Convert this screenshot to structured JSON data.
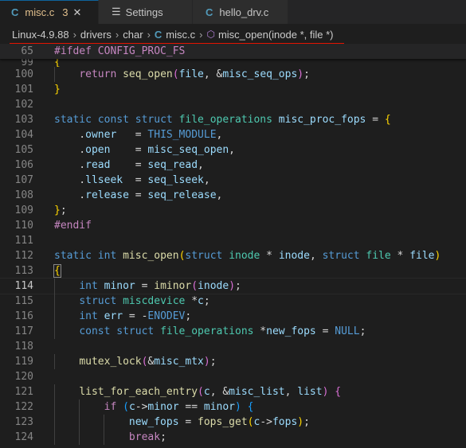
{
  "tabs": [
    {
      "icon": "C",
      "label": "misc.c",
      "badge": "3",
      "close": "✕",
      "active": true
    },
    {
      "icon": "☰",
      "label": "Settings",
      "active": false
    },
    {
      "icon": "C",
      "label": "hello_drv.c",
      "active": false
    }
  ],
  "breadcrumb": {
    "items": [
      "Linux-4.9.88",
      "drivers",
      "char",
      "misc.c",
      "misc_open(inode *, file *)"
    ],
    "file_icon": "C"
  },
  "sticky_line": {
    "num": "65",
    "text": "#ifdef CONFIG_PROC_FS"
  },
  "lines": [
    {
      "num": "99",
      "tokens": [
        {
          "c": "br1",
          "t": "{"
        }
      ]
    },
    {
      "num": "100",
      "tokens": [
        {
          "c": "pl",
          "t": "    "
        },
        {
          "c": "ctl",
          "t": "return"
        },
        {
          "c": "pl",
          "t": " "
        },
        {
          "c": "fn",
          "t": "seq_open"
        },
        {
          "c": "br2",
          "t": "("
        },
        {
          "c": "vr",
          "t": "file"
        },
        {
          "c": "pl",
          "t": ", &"
        },
        {
          "c": "vr",
          "t": "misc_seq_ops"
        },
        {
          "c": "br2",
          "t": ")"
        },
        {
          "c": "pl",
          "t": ";"
        }
      ]
    },
    {
      "num": "101",
      "tokens": [
        {
          "c": "br1",
          "t": "}"
        }
      ]
    },
    {
      "num": "102",
      "tokens": []
    },
    {
      "num": "103",
      "tokens": [
        {
          "c": "kw",
          "t": "static"
        },
        {
          "c": "pl",
          "t": " "
        },
        {
          "c": "kw",
          "t": "const"
        },
        {
          "c": "pl",
          "t": " "
        },
        {
          "c": "kw",
          "t": "struct"
        },
        {
          "c": "pl",
          "t": " "
        },
        {
          "c": "ty",
          "t": "file_operations"
        },
        {
          "c": "pl",
          "t": " "
        },
        {
          "c": "vr",
          "t": "misc_proc_fops"
        },
        {
          "c": "pl",
          "t": " = "
        },
        {
          "c": "br1",
          "t": "{"
        }
      ]
    },
    {
      "num": "104",
      "tokens": [
        {
          "c": "pl",
          "t": "    ."
        },
        {
          "c": "vr",
          "t": "owner"
        },
        {
          "c": "pl",
          "t": "   = "
        },
        {
          "c": "mac",
          "t": "THIS_MODULE"
        },
        {
          "c": "pl",
          "t": ","
        }
      ]
    },
    {
      "num": "105",
      "tokens": [
        {
          "c": "pl",
          "t": "    ."
        },
        {
          "c": "vr",
          "t": "open"
        },
        {
          "c": "pl",
          "t": "    = "
        },
        {
          "c": "vr",
          "t": "misc_seq_open"
        },
        {
          "c": "pl",
          "t": ","
        }
      ]
    },
    {
      "num": "106",
      "tokens": [
        {
          "c": "pl",
          "t": "    ."
        },
        {
          "c": "vr",
          "t": "read"
        },
        {
          "c": "pl",
          "t": "    = "
        },
        {
          "c": "vr",
          "t": "seq_read"
        },
        {
          "c": "pl",
          "t": ","
        }
      ]
    },
    {
      "num": "107",
      "tokens": [
        {
          "c": "pl",
          "t": "    ."
        },
        {
          "c": "vr",
          "t": "llseek"
        },
        {
          "c": "pl",
          "t": "  = "
        },
        {
          "c": "vr",
          "t": "seq_lseek"
        },
        {
          "c": "pl",
          "t": ","
        }
      ]
    },
    {
      "num": "108",
      "tokens": [
        {
          "c": "pl",
          "t": "    ."
        },
        {
          "c": "vr",
          "t": "release"
        },
        {
          "c": "pl",
          "t": " = "
        },
        {
          "c": "vr",
          "t": "seq_release"
        },
        {
          "c": "pl",
          "t": ","
        }
      ]
    },
    {
      "num": "109",
      "tokens": [
        {
          "c": "br1",
          "t": "}"
        },
        {
          "c": "pl",
          "t": ";"
        }
      ]
    },
    {
      "num": "110",
      "tokens": [
        {
          "c": "pp",
          "t": "#endif"
        }
      ]
    },
    {
      "num": "111",
      "tokens": []
    },
    {
      "num": "112",
      "tokens": [
        {
          "c": "kw",
          "t": "static"
        },
        {
          "c": "pl",
          "t": " "
        },
        {
          "c": "kw",
          "t": "int"
        },
        {
          "c": "pl",
          "t": " "
        },
        {
          "c": "fn",
          "t": "misc_open"
        },
        {
          "c": "br1",
          "t": "("
        },
        {
          "c": "kw",
          "t": "struct"
        },
        {
          "c": "pl",
          "t": " "
        },
        {
          "c": "ty",
          "t": "inode"
        },
        {
          "c": "pl",
          "t": " * "
        },
        {
          "c": "vr",
          "t": "inode"
        },
        {
          "c": "pl",
          "t": ", "
        },
        {
          "c": "kw",
          "t": "struct"
        },
        {
          "c": "pl",
          "t": " "
        },
        {
          "c": "ty",
          "t": "file"
        },
        {
          "c": "pl",
          "t": " * "
        },
        {
          "c": "vr",
          "t": "file"
        },
        {
          "c": "br1",
          "t": ")"
        }
      ]
    },
    {
      "num": "113",
      "tokens": [
        {
          "c": "br1 bracket-box",
          "t": "{"
        }
      ]
    },
    {
      "num": "114",
      "cur": true,
      "tokens": [
        {
          "c": "pl",
          "t": "    "
        },
        {
          "c": "kw",
          "t": "int"
        },
        {
          "c": "pl",
          "t": " "
        },
        {
          "c": "vr",
          "t": "minor"
        },
        {
          "c": "pl",
          "t": " = "
        },
        {
          "c": "fn",
          "t": "iminor"
        },
        {
          "c": "br2",
          "t": "("
        },
        {
          "c": "vr",
          "t": "inode"
        },
        {
          "c": "br2",
          "t": ")"
        },
        {
          "c": "pl",
          "t": ";"
        }
      ]
    },
    {
      "num": "115",
      "tokens": [
        {
          "c": "pl",
          "t": "    "
        },
        {
          "c": "kw",
          "t": "struct"
        },
        {
          "c": "pl",
          "t": " "
        },
        {
          "c": "ty",
          "t": "miscdevice"
        },
        {
          "c": "pl",
          "t": " *"
        },
        {
          "c": "vr",
          "t": "c"
        },
        {
          "c": "pl",
          "t": ";"
        }
      ]
    },
    {
      "num": "116",
      "tokens": [
        {
          "c": "pl",
          "t": "    "
        },
        {
          "c": "kw",
          "t": "int"
        },
        {
          "c": "pl",
          "t": " "
        },
        {
          "c": "vr",
          "t": "err"
        },
        {
          "c": "pl",
          "t": " = -"
        },
        {
          "c": "mac",
          "t": "ENODEV"
        },
        {
          "c": "pl",
          "t": ";"
        }
      ]
    },
    {
      "num": "117",
      "tokens": [
        {
          "c": "pl",
          "t": "    "
        },
        {
          "c": "kw",
          "t": "const"
        },
        {
          "c": "pl",
          "t": " "
        },
        {
          "c": "kw",
          "t": "struct"
        },
        {
          "c": "pl",
          "t": " "
        },
        {
          "c": "ty",
          "t": "file_operations"
        },
        {
          "c": "pl",
          "t": " *"
        },
        {
          "c": "vr",
          "t": "new_fops"
        },
        {
          "c": "pl",
          "t": " = "
        },
        {
          "c": "mac",
          "t": "NULL"
        },
        {
          "c": "pl",
          "t": ";"
        }
      ]
    },
    {
      "num": "118",
      "tokens": []
    },
    {
      "num": "119",
      "tokens": [
        {
          "c": "pl",
          "t": "    "
        },
        {
          "c": "fn",
          "t": "mutex_lock"
        },
        {
          "c": "br2",
          "t": "("
        },
        {
          "c": "pl",
          "t": "&"
        },
        {
          "c": "vr",
          "t": "misc_mtx"
        },
        {
          "c": "br2",
          "t": ")"
        },
        {
          "c": "pl",
          "t": ";"
        }
      ]
    },
    {
      "num": "120",
      "tokens": []
    },
    {
      "num": "121",
      "tokens": [
        {
          "c": "pl",
          "t": "    "
        },
        {
          "c": "fn",
          "t": "list_for_each_entry"
        },
        {
          "c": "br2",
          "t": "("
        },
        {
          "c": "vr",
          "t": "c"
        },
        {
          "c": "pl",
          "t": ", &"
        },
        {
          "c": "vr",
          "t": "misc_list"
        },
        {
          "c": "pl",
          "t": ", "
        },
        {
          "c": "vr",
          "t": "list"
        },
        {
          "c": "br2",
          "t": ")"
        },
        {
          "c": "pl",
          "t": " "
        },
        {
          "c": "br2",
          "t": "{"
        }
      ]
    },
    {
      "num": "122",
      "tokens": [
        {
          "c": "pl",
          "t": "        "
        },
        {
          "c": "ctl",
          "t": "if"
        },
        {
          "c": "pl",
          "t": " "
        },
        {
          "c": "br3",
          "t": "("
        },
        {
          "c": "vr",
          "t": "c"
        },
        {
          "c": "pl",
          "t": "->"
        },
        {
          "c": "vr",
          "t": "minor"
        },
        {
          "c": "pl",
          "t": " == "
        },
        {
          "c": "vr",
          "t": "minor"
        },
        {
          "c": "br3",
          "t": ")"
        },
        {
          "c": "pl",
          "t": " "
        },
        {
          "c": "br3",
          "t": "{"
        }
      ]
    },
    {
      "num": "123",
      "tokens": [
        {
          "c": "pl",
          "t": "            "
        },
        {
          "c": "vr",
          "t": "new_fops"
        },
        {
          "c": "pl",
          "t": " = "
        },
        {
          "c": "fn",
          "t": "fops_get"
        },
        {
          "c": "br1",
          "t": "("
        },
        {
          "c": "vr",
          "t": "c"
        },
        {
          "c": "pl",
          "t": "->"
        },
        {
          "c": "vr",
          "t": "fops"
        },
        {
          "c": "br1",
          "t": ")"
        },
        {
          "c": "pl",
          "t": ";"
        }
      ]
    },
    {
      "num": "124",
      "tokens": [
        {
          "c": "pl",
          "t": "            "
        },
        {
          "c": "ctl",
          "t": "break"
        },
        {
          "c": "pl",
          "t": ";"
        }
      ]
    }
  ]
}
